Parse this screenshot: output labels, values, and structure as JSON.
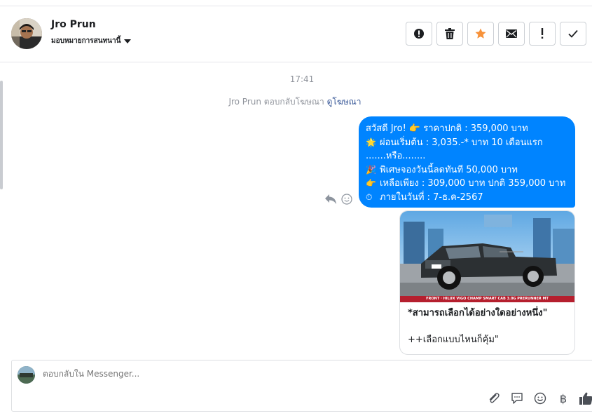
{
  "header": {
    "name": "Jro Prun",
    "assign_label": "มอบหมายการสนทนานี้"
  },
  "toolbar": {
    "buttons": [
      "spam-icon",
      "trash-icon",
      "star-icon",
      "envelope-icon",
      "exclamation-icon",
      "check-icon"
    ],
    "star_color": "#f7923a"
  },
  "conversation": {
    "time": "17:41",
    "ad_reply_text": "Jro Prun ตอบกลับโฆษณา",
    "ad_link": "ดูโฆษณา",
    "message": {
      "line1": "สวัสดี Jro! 👉 ราคาปกติ : 359,000 บาท",
      "line2": "ผ่อนเริ่มต้น : 3,035.-* บาท 10 เดือนแรก",
      "line3": ".......หรือ........",
      "line4": "พิเศษจองวันนี้ลดทันที 50,000 บาท",
      "line5": "เหลือเพียง : 309,000 บาท ปกติ 359,000 บาท",
      "line6": "ภายในวันที่ : 7-ธ.ค-2567",
      "emoji2": "🌟",
      "emoji4": "🎉",
      "emoji5": "👉",
      "emoji6": "⏱"
    },
    "card": {
      "caption": "FRONT · HILUX VIGO CHAMP SMART CAB 3.0G PRERUNNER MT",
      "title": "*สามารถเลือกได้อย่างใดอย่างหนึ่ง\"",
      "subtitle": "++เลือกแบบไหนก็คุ้ม\""
    },
    "accent_color": "#0084ff"
  },
  "composer": {
    "placeholder": "ตอบกลับใน Messenger...",
    "baht_symbol": "฿"
  }
}
